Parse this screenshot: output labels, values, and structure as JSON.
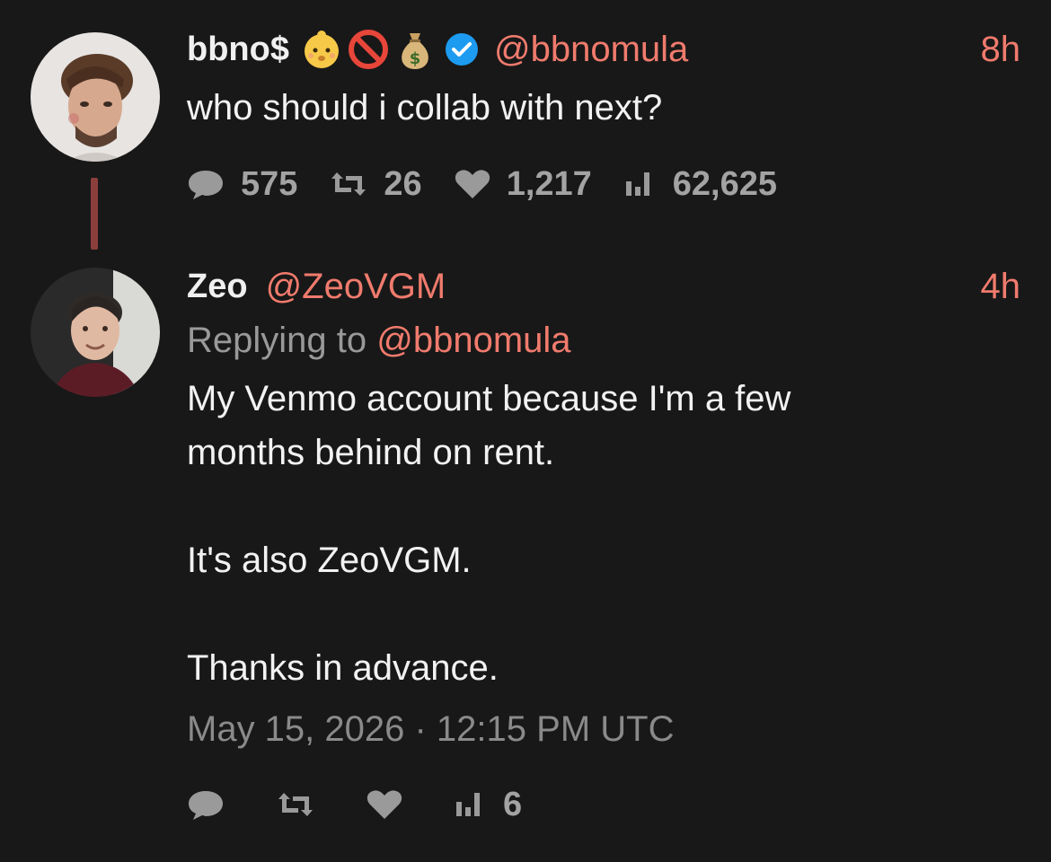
{
  "tweet1": {
    "display_name": "bbno$",
    "emojis": [
      "baby-face-icon",
      "prohibited-icon",
      "money-bag-icon"
    ],
    "verified_icon": "verified-badge-icon",
    "handle": "@bbnomula",
    "time": "8h",
    "text": "who should i collab with next?",
    "stats": {
      "replies": "575",
      "retweets": "26",
      "likes": "1,217",
      "views": "62,625"
    }
  },
  "tweet2": {
    "display_name": "Zeo",
    "handle": "@ZeoVGM",
    "time": "4h",
    "replying_prefix": "Replying to",
    "replying_handle": "@bbnomula",
    "text": "My Venmo account because I'm a few\nmonths behind on rent.\n\nIt's also ZeoVGM.\n\nThanks in advance.",
    "timestamp": "May 15, 2026 · 12:15 PM UTC",
    "stats": {
      "views": "6"
    }
  },
  "colors": {
    "background": "#181818",
    "accent": "#f07b6d",
    "thread_line": "#8b3f3c",
    "muted": "#9a9a9a",
    "verified": "#1d9bf0"
  }
}
